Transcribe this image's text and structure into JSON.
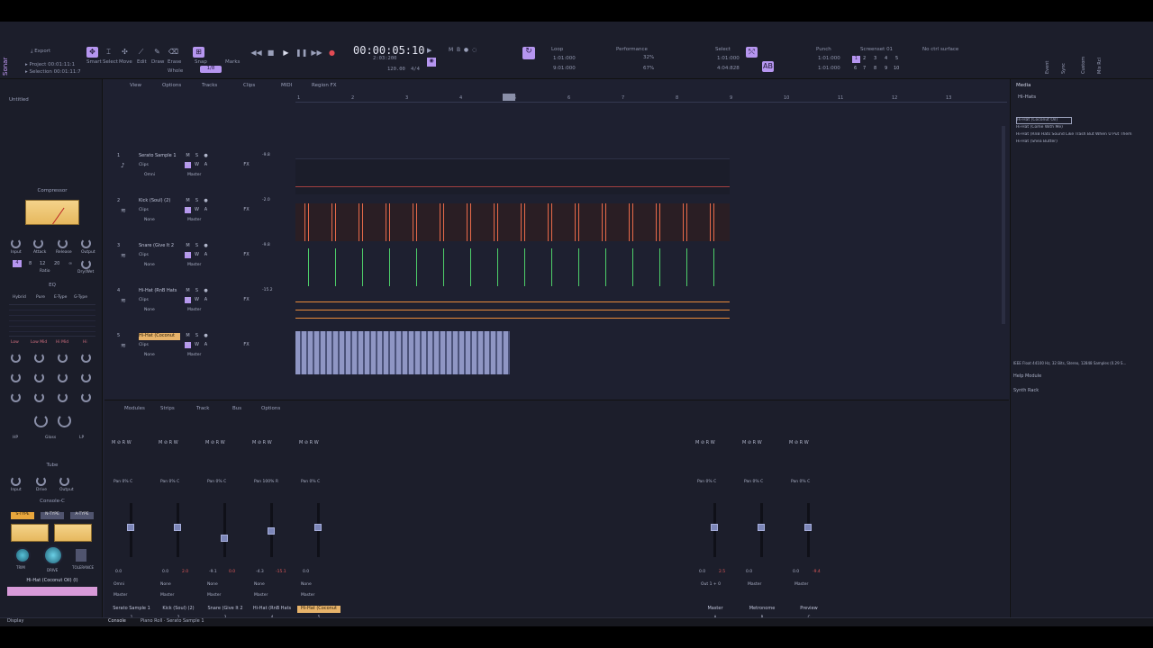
{
  "app": {
    "name": "Sonar",
    "title": "Untitled"
  },
  "control_bar": {
    "export_label": "Export",
    "project_label": "Project",
    "project_time": "00:01:11:1",
    "selection_label": "Selection",
    "selection_time": "00:01:11:7",
    "tool_labels": [
      "Smart",
      "Select",
      "Move",
      "Edit",
      "Draw",
      "Erase"
    ],
    "snap_label": "Snap",
    "snap_value": "1/8",
    "whole_label": "Whole",
    "marks_label": "Marks",
    "time_display": "00:00:05:10",
    "time_sub": "2:03:200",
    "bpm": "120.00",
    "meter": "4/4",
    "loop_label": "Loop",
    "loop_start": "1:01:000",
    "loop_end": "9:01:000",
    "performance_label": "Performance",
    "perf_cpu": "32%",
    "perf_disk": "67%",
    "select_label": "Select",
    "select_start": "1:01:000",
    "select_end": "4:04:828",
    "punch_label": "Punch",
    "punch_start": "1:01:000",
    "punch_end": "1:01:000",
    "screenset_label": "Screenset 01",
    "screenset_numbers": [
      "1",
      "2",
      "3",
      "4",
      "5",
      "6",
      "7",
      "8",
      "9",
      "10"
    ],
    "ctrl_surface": "No ctrl surface",
    "right_labels": [
      "Event",
      "Sync",
      "Custom",
      "Mix Rcl"
    ]
  },
  "inspector": {
    "compressor_title": "Compressor",
    "comp_knobs": [
      "Input",
      "Attack",
      "Release",
      "Output"
    ],
    "comp_ratio_values": [
      "4",
      "8",
      "12",
      "20",
      "∞"
    ],
    "comp_ratio_label": "Ratio",
    "comp_drywet": "Dry/Wet",
    "eq_title": "EQ",
    "eq_modes": [
      "Hybrid",
      "Pure",
      "E-Type",
      "G-Type"
    ],
    "eq_bands": [
      "Low",
      "Low Mid",
      "Hi Mid",
      "Hi"
    ],
    "eq_gloss": "Gloss",
    "eq_hp": "HP",
    "eq_lp": "LP",
    "tube_title": "Tube",
    "tube_knobs": [
      "Input",
      "Drive",
      "Output"
    ],
    "console_title": "Console-C",
    "console_buttons": [
      "S-TYPE",
      "N-TYPE",
      "A-TYPE"
    ],
    "console_knobs": [
      "TRIM",
      "DRIVE",
      "TOLERANCE"
    ],
    "track_name": "Hi-Hat (Coconut Oil) (I)",
    "display_label": "Display"
  },
  "track_view": {
    "menus": [
      "View",
      "Options",
      "Tracks",
      "Clips",
      "MIDI",
      "Region FX"
    ],
    "ruler": [
      "1",
      "2",
      "3",
      "4",
      "5",
      "6",
      "7",
      "8",
      "9",
      "10",
      "11",
      "12",
      "13"
    ],
    "tracks": [
      {
        "num": "1",
        "name": "Serato Sample 1",
        "input": "Omni",
        "output": "Master",
        "clips": "Clips",
        "gain": "-9.8"
      },
      {
        "num": "2",
        "name": "Kick (Soul) (2)",
        "input": "None",
        "output": "Master",
        "clips": "Clips",
        "gain": "-2.0"
      },
      {
        "num": "3",
        "name": "Snare (Give It 2",
        "input": "None",
        "output": "Master",
        "clips": "Clips",
        "gain": "-9.8"
      },
      {
        "num": "4",
        "name": "Hi-Hat (RnB Hats",
        "input": "None",
        "output": "Master",
        "clips": "Clips",
        "gain": "-15.2"
      },
      {
        "num": "5",
        "name": "Hi-Hat (Coconut",
        "input": "None",
        "output": "Master",
        "clips": "Clips",
        "gain": ""
      }
    ],
    "button_letters": [
      "M",
      "S",
      "●",
      "W",
      "A",
      "FX"
    ]
  },
  "browser": {
    "tabs": [
      "Media"
    ],
    "folder": "Hi-Hats",
    "files": [
      "Hi-Hat (Coconut Oil)",
      "Hi-Hat (Come With Me)",
      "Hi-Hat (RnB Hats Sound Like Trash But When U Put Them",
      "Hi-Hat (Shea Butter)"
    ],
    "file_info": "IEEE Float 44100 Hz, 32 Bits, Stereo, 12848 Samples (0.29 S...",
    "help_module": "Help Module",
    "synth_rack": "Synth Rack"
  },
  "console": {
    "menus": [
      "Modules",
      "Strips",
      "Track",
      "Bus",
      "Options"
    ],
    "strips": [
      {
        "name": "Serato Sample 1",
        "num": "1",
        "pan": "Pan 0% C",
        "vol": "0.0",
        "in": "Omni",
        "out": "Master",
        "level": 0.62
      },
      {
        "name": "Kick (Soul) (2)",
        "num": "2",
        "pan": "Pan 0% C",
        "vol": "0.0",
        "peak": "2.0",
        "in": "None",
        "out": "Master",
        "level": 0.62
      },
      {
        "name": "Snare (Give It 2",
        "num": "3",
        "pan": "Pan 0% C",
        "vol": "-9.1",
        "peak": "0.0",
        "in": "None",
        "out": "Master",
        "level": 0.42
      },
      {
        "name": "Hi-Hat (RnB Hats",
        "num": "4",
        "pan": "Pan 100% R",
        "vol": "-4.3",
        "peak": "-15.1",
        "in": "None",
        "out": "Master",
        "level": 0.55
      },
      {
        "name": "Hi-Hat (Coconut",
        "num": "5",
        "pan": "Pan 0% C",
        "vol": "0.0",
        "in": "None",
        "out": "Master",
        "level": 0.62
      }
    ],
    "buses": [
      {
        "name": "Master",
        "num": "A",
        "pan": "Pan 0% C",
        "vol": "0.0",
        "peak": "2.5",
        "out": "Out 1 + 0",
        "level": 0.62
      },
      {
        "name": "Metronome",
        "num": "B",
        "pan": "Pan 0% C",
        "vol": "0.0",
        "out": "Master",
        "level": 0.62
      },
      {
        "name": "Preview",
        "num": "C",
        "pan": "Pan 0% C",
        "vol": "0.0",
        "peak": "-9.4",
        "out": "Master",
        "level": 0.62
      }
    ]
  },
  "status_bar": {
    "tabs": [
      "Console",
      "Piano Roll · Serato Sample 1"
    ]
  }
}
